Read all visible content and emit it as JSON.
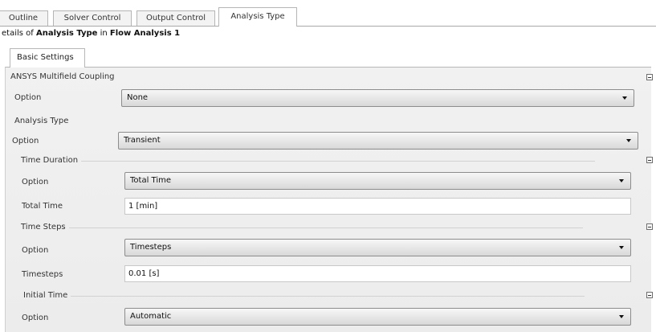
{
  "tabs": [
    {
      "label": "Outline"
    },
    {
      "label": "Solver Control"
    },
    {
      "label": "Output Control"
    },
    {
      "label": "Analysis Type",
      "active": true
    }
  ],
  "breadcrumb": {
    "prefix": "etails of ",
    "object": "Analysis Type",
    "mid": " in ",
    "parent": "Flow Analysis 1"
  },
  "subtab": {
    "label": "Basic Settings"
  },
  "sections": {
    "multifield": {
      "title": "ANSYS Multifield Coupling",
      "option_label": "Option",
      "option_value": "None"
    },
    "analysis_type": {
      "title": "Analysis Type",
      "option_label": "Option",
      "option_value": "Transient"
    },
    "time_duration": {
      "title": "Time Duration",
      "option_label": "Option",
      "option_value": "Total Time",
      "total_time_label": "Total Time",
      "total_time_value": "1 [min]"
    },
    "time_steps": {
      "title": "Time Steps",
      "option_label": "Option",
      "option_value": "Timesteps",
      "timesteps_label": "Timesteps",
      "timesteps_value": "0.01 [s]"
    },
    "initial_time": {
      "title": "Initial Time",
      "option_label": "Option",
      "option_value": "Automatic"
    }
  },
  "icons": {
    "collapse": "collapse-box-icon",
    "dropdown": "chevron-down-icon"
  }
}
